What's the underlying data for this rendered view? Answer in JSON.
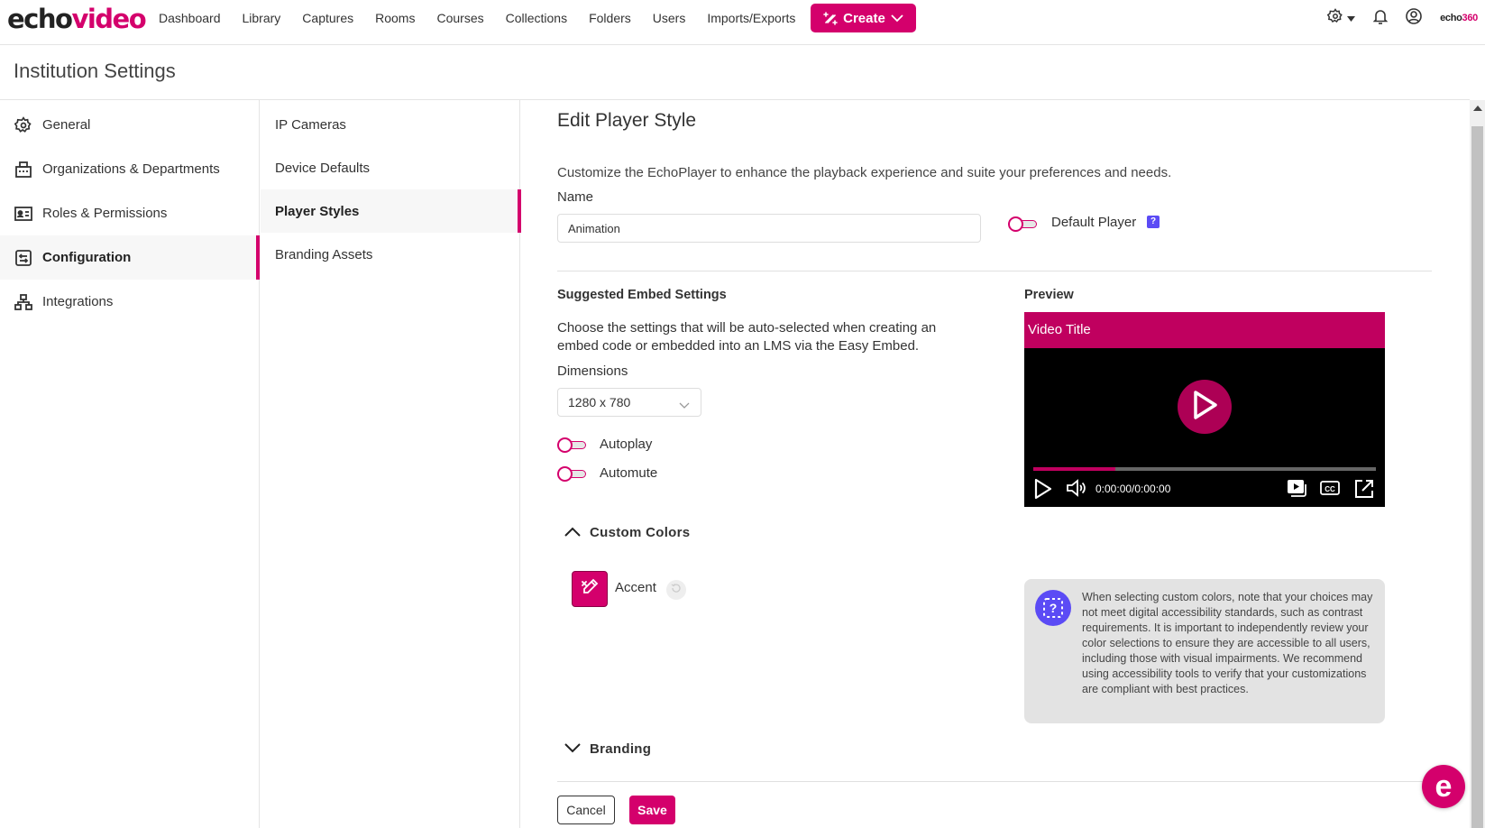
{
  "app": {
    "logo_part1": "echo",
    "logo_part2": "video",
    "brand_small_part1": "echo",
    "brand_small_part2": "360"
  },
  "topnav": {
    "links": [
      "Dashboard",
      "Library",
      "Captures",
      "Rooms",
      "Courses",
      "Collections",
      "Folders",
      "Users",
      "Imports/Exports"
    ],
    "create_label": "Create",
    "icons": [
      "settings-icon",
      "bell-icon",
      "user-account-icon"
    ]
  },
  "page": {
    "title": "Institution Settings"
  },
  "sidebar": {
    "items": [
      {
        "label": "General",
        "icon": "gear-icon",
        "active": false
      },
      {
        "label": "Organizations & Departments",
        "icon": "building-icon",
        "active": false
      },
      {
        "label": "Roles & Permissions",
        "icon": "id-card-icon",
        "active": false
      },
      {
        "label": "Configuration",
        "icon": "config-icon",
        "active": true
      },
      {
        "label": "Integrations",
        "icon": "network-icon",
        "active": false
      }
    ]
  },
  "subnav": {
    "items": [
      {
        "label": "IP Cameras",
        "active": false
      },
      {
        "label": "Device Defaults",
        "active": false
      },
      {
        "label": "Player Styles",
        "active": true
      },
      {
        "label": "Branding Assets",
        "active": false
      }
    ]
  },
  "editor": {
    "heading": "Edit Player Style",
    "description": "Customize the EchoPlayer to enhance the playback experience and suite your preferences and needs.",
    "name_label": "Name",
    "name_value": "Animation",
    "default_player_label": "Default Player",
    "default_player_on": false,
    "help_badge": "?",
    "embed": {
      "title": "Suggested Embed Settings",
      "description": "Choose the settings that will be auto-selected when creating an embed code or embedded into an LMS via the Easy Embed.",
      "dimensions_label": "Dimensions",
      "dimensions_value": "1280 x 780",
      "autoplay_label": "Autoplay",
      "autoplay_on": false,
      "automute_label": "Automute",
      "automute_on": false
    },
    "custom_colors": {
      "title": "Custom Colors",
      "expanded": true,
      "accent_label": "Accent",
      "accent_color": "#d4006c"
    },
    "branding": {
      "title": "Branding",
      "expanded": false
    },
    "cancel_label": "Cancel",
    "save_label": "Save"
  },
  "preview": {
    "label": "Preview",
    "video_title": "Video Title",
    "timecode": "0:00:00/0:00:00",
    "progress_fraction": 0.24,
    "accent_color": "#c0005f"
  },
  "info": {
    "text": "When selecting custom colors, note that your choices may not meet digital accessibility standards, such as contrast requirements. It is important to independently review your color selections to ensure they are accessible to all users, including those with visual impairments. We recommend using accessibility tools to verify that your customizations are compliant with best practices."
  },
  "chat": {
    "glyph": "e"
  }
}
